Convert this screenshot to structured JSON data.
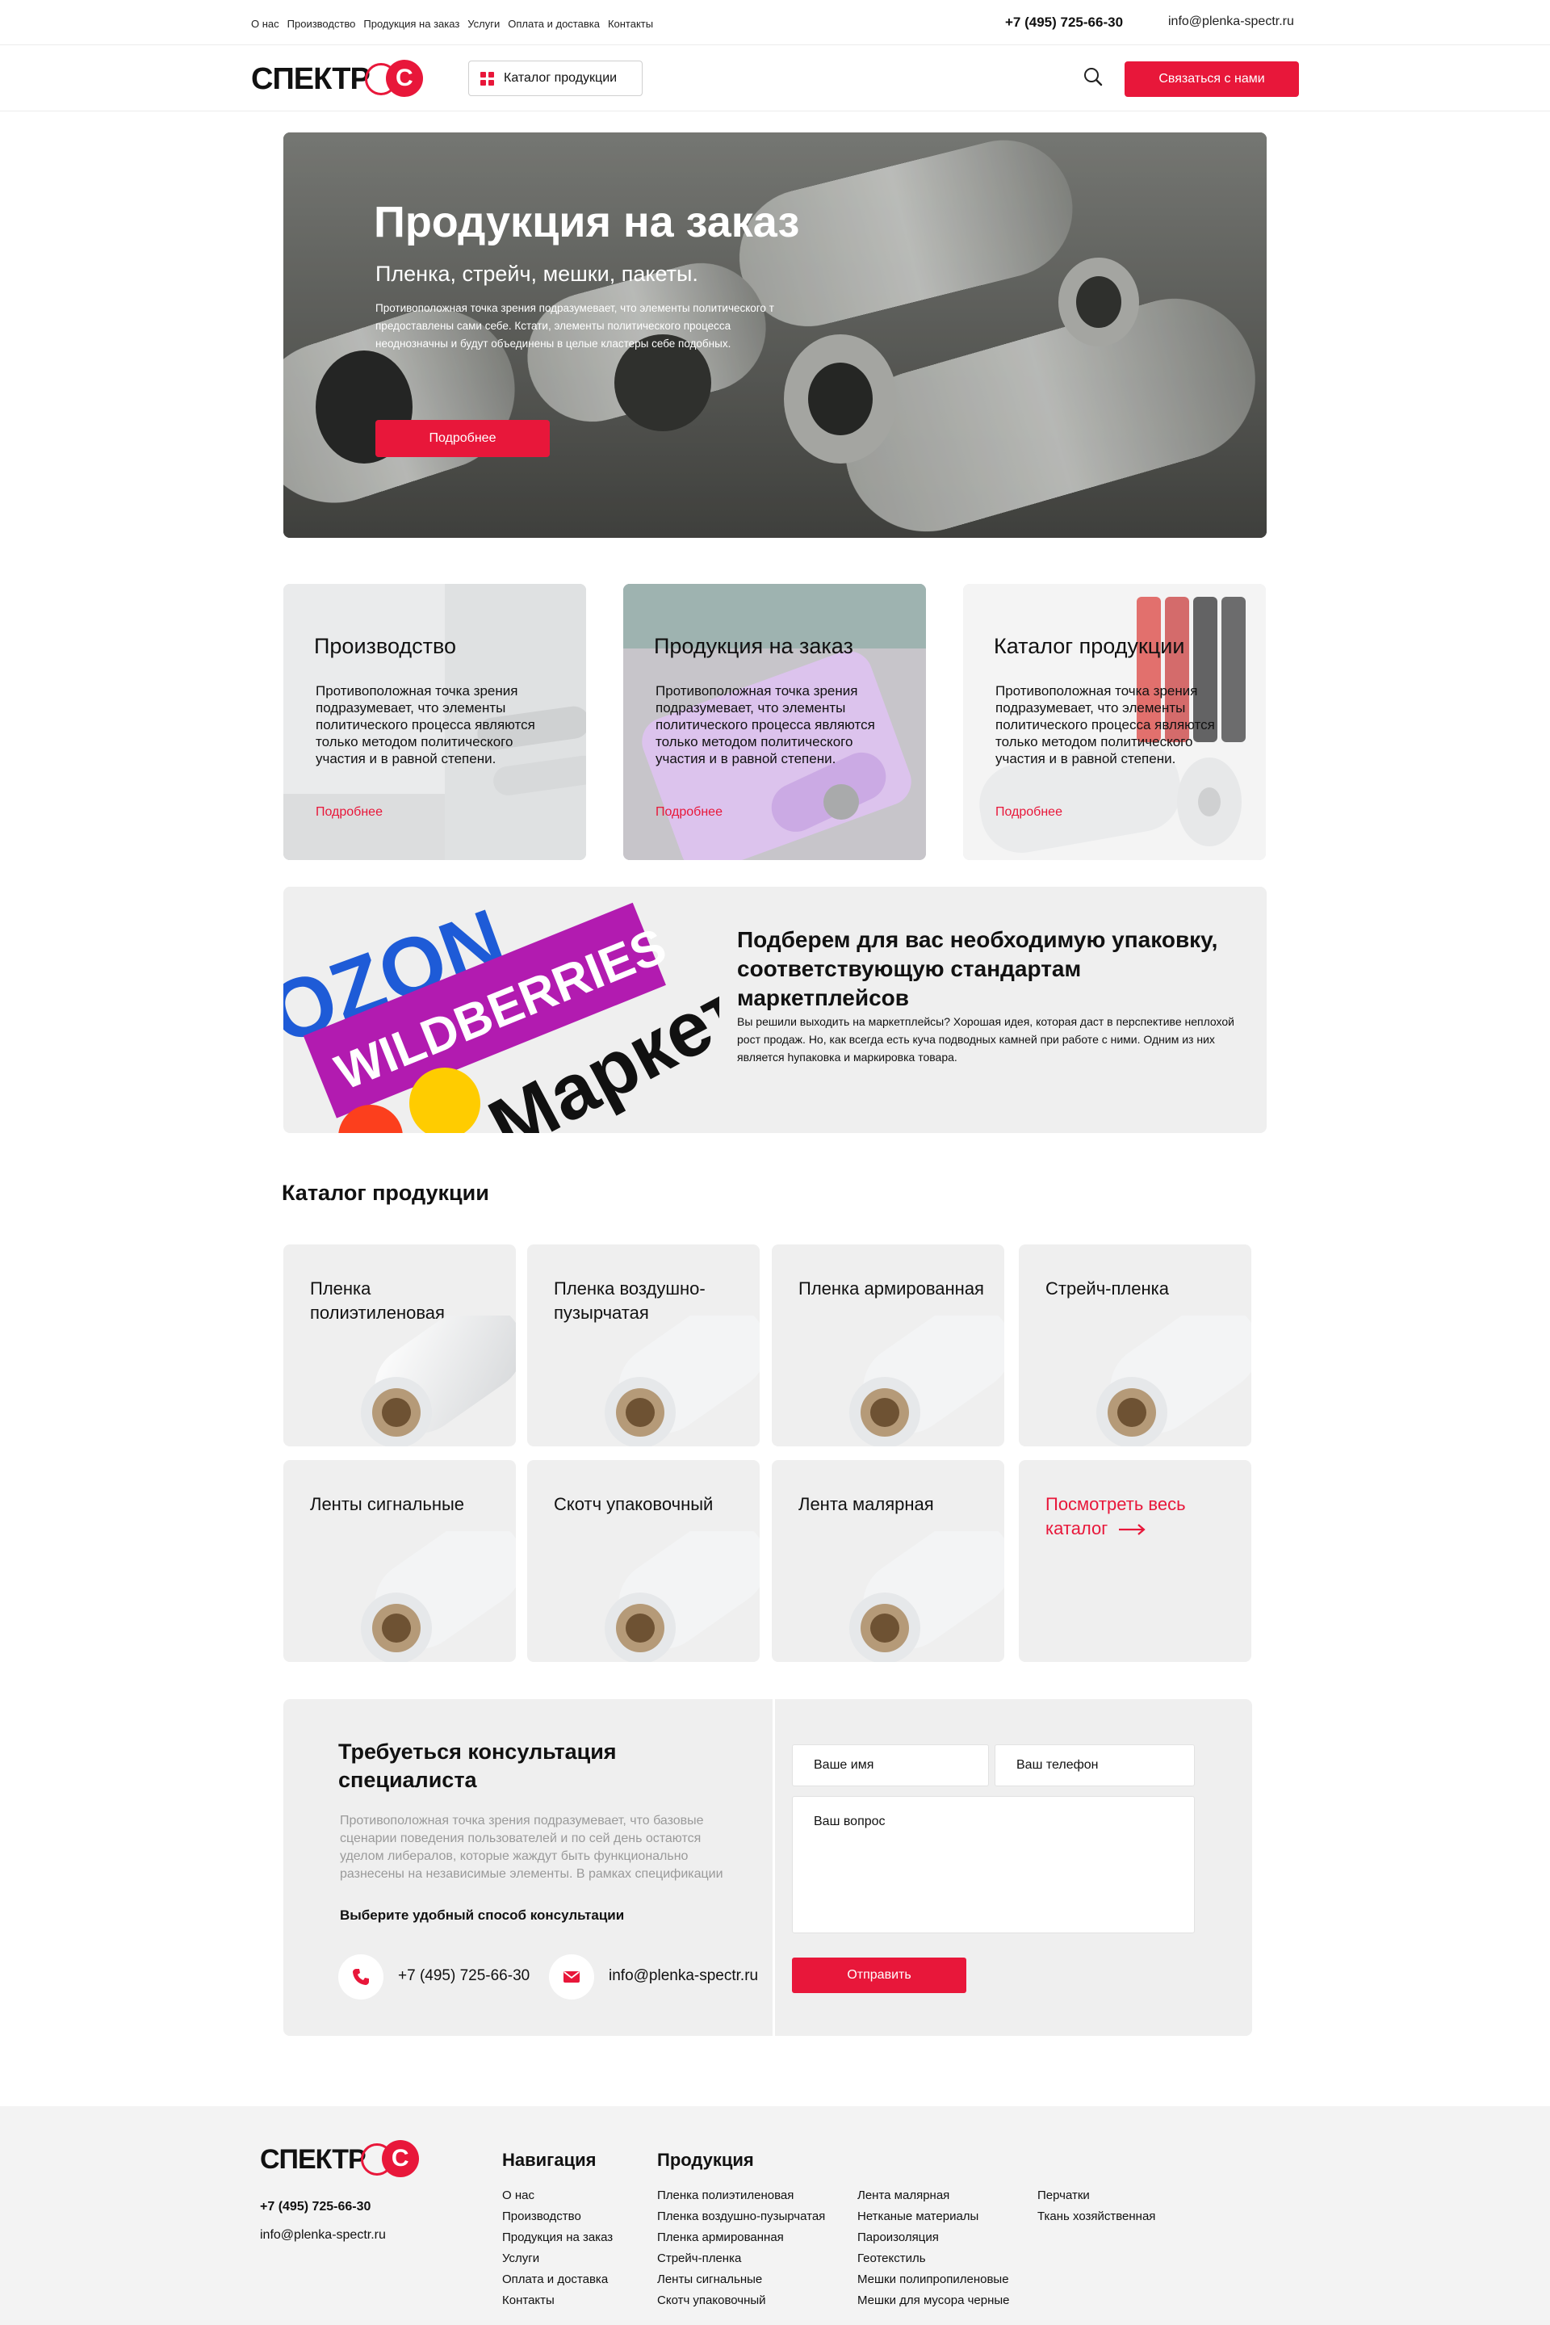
{
  "topnav": [
    "О нас",
    "Производство",
    "Продукция на заказ",
    "Услуги",
    "Оплата и доставка",
    "Контакты"
  ],
  "contacts": {
    "phone": "+7 (495) 725-66-30",
    "email": "info@plenka-spectr.ru"
  },
  "header": {
    "logo_text": "СПЕКТР",
    "logo_mark": "С",
    "catalog_button": "Каталог продукции",
    "contact_button": "Связаться с нами",
    "icons": [
      "grid-icon",
      "search-icon"
    ]
  },
  "hero": {
    "title": "Продукция на заказ",
    "subtitle": "Пленка, стрейч, мешки, пакеты.",
    "text": "Противоположная точка зрения подразумевает, что элементы политического т предоставлены сами себе. Кстати, элементы политического процесса неоднозначны и будут объединены в целые кластеры себе подобных.",
    "button": "Подробнее"
  },
  "features": [
    {
      "title": "Производство",
      "text": "Противоположная точка зрения подразумевает, что элементы политического процесса являются только методом политического участия и в равной степени.",
      "link": "Подробнее"
    },
    {
      "title": "Продукция на заказ",
      "text": "Противоположная точка зрения подразумевает, что элементы политического процесса являются только методом политического участия и в равной степени.",
      "link": "Подробнее"
    },
    {
      "title": "Каталог продукции",
      "text": "Противоположная точка зрения подразумевает, что элементы политического процесса являются только методом политического участия и в равной степени.",
      "link": "Подробнее"
    }
  ],
  "marketplace": {
    "logos": [
      "OZON",
      "WILDBERRIES",
      "Маркет"
    ],
    "title": "Подберем для вас необходимую упаковку, соответствующую стандартам маркетплейсов",
    "text": "Вы решили выходить на маркетплейсы? Хорошая идея, которая даст в перспективе неплохой рост продаж. Но, как всегда есть куча подводных камней при работе с ними. Одним из них является hупаковка и маркировка товара."
  },
  "catalog": {
    "title": "Каталог продукции",
    "items": [
      "Пленка полиэтиленовая",
      "Пленка воздушно-пузырчатая",
      "Пленка армированная",
      "Стрейч-пленка",
      "Ленты сигнальные",
      "Скотч упаковочный",
      "Лента малярная"
    ],
    "all_link": "Посмотреть весь каталог"
  },
  "consult": {
    "title": "Требуеться консультация специалиста",
    "text": "Противоположная точка зрения подразумевает, что базовые сценарии поведения пользователей и по сей день остаются уделом либералов, которые жаждут быть функционально разнесены на независимые элементы. В рамках спецификации",
    "choose": "Выберите удобный способ консультации",
    "name_placeholder": "Ваше имя",
    "phone_placeholder": "Ваш телефон",
    "question_placeholder": "Ваш вопрос",
    "submit": "Отправить",
    "icons": [
      "phone-icon",
      "mail-icon"
    ]
  },
  "footer": {
    "nav_title": "Навигация",
    "nav": [
      "О нас",
      "Производство",
      "Продукция на заказ",
      "Услуги",
      "Оплата и доставка",
      "Контакты"
    ],
    "products_title": "Продукция",
    "products_col1": [
      "Пленка полиэтиленовая",
      "Пленка воздушно-пузырчатая",
      "Пленка армированная",
      "Стрейч-пленка",
      "Ленты сигнальные",
      "Скотч упаковочный"
    ],
    "products_col2": [
      "Лента малярная",
      "Нетканые материалы",
      "Пароизоляция",
      "Геотекстиль",
      "Мешки полипропиленовые",
      "Мешки для мусора черные"
    ],
    "products_col3": [
      "Перчатки",
      "Ткань хозяйственная"
    ]
  },
  "colors": {
    "accent": "#e8173a",
    "card_bg": "#efefef"
  }
}
